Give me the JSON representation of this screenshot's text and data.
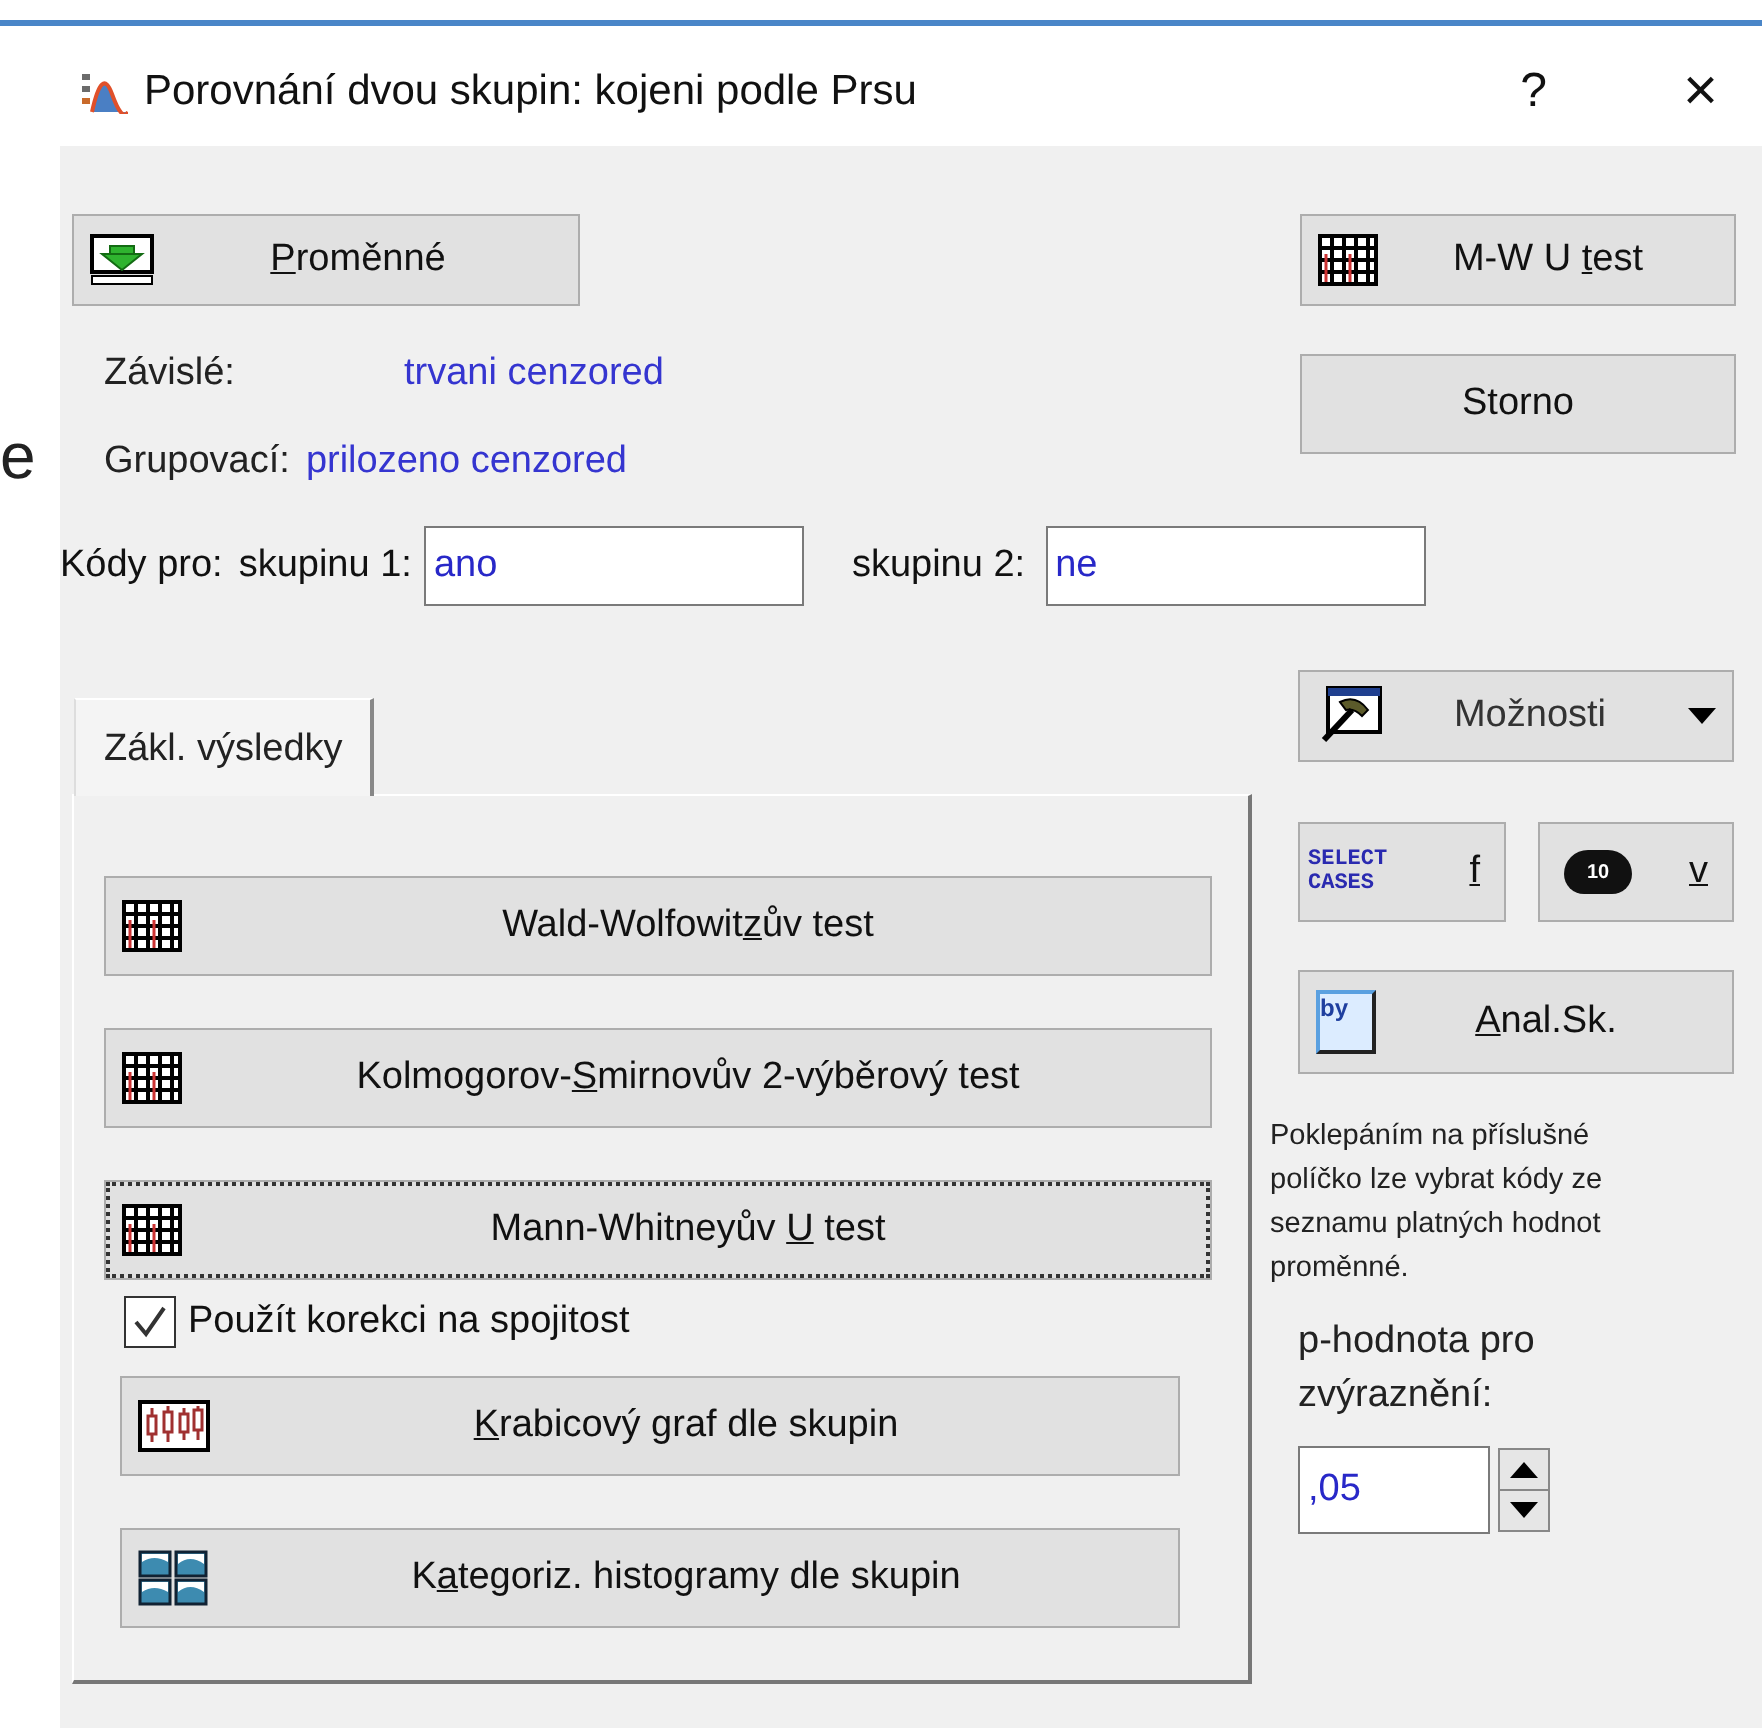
{
  "background_text": "e",
  "window": {
    "title": "Porovnání dvou skupin: kojeni podle Prsu",
    "help": "?",
    "close": "×"
  },
  "variables_button": {
    "key": "P",
    "post": "roměnné"
  },
  "mw_button": {
    "pre": "M-W U ",
    "key": "t",
    "post": "est"
  },
  "cancel_button": "Storno",
  "variables": [
    {
      "label": "Závislé:",
      "value": "trvani cenzored"
    },
    {
      "label": "Grupovací:",
      "value": "prilozeno cenzored"
    }
  ],
  "codes": {
    "label": "Kódy pro:",
    "group1_label": "skupinu 1:",
    "group1_value": "ano",
    "group2_label": "skupinu 2:",
    "group2_value": "ne"
  },
  "tabs": [
    {
      "label": "Zákl. výsledky",
      "selected": true
    }
  ],
  "tests": [
    {
      "kind": "table",
      "focused": false,
      "label": {
        "pre": "Wald-Wolfowit",
        "key": "z",
        "post": "ův test"
      }
    },
    {
      "kind": "table",
      "focused": false,
      "label": {
        "pre": "Kolmogorov-",
        "key": "S",
        "post": "mirnovův 2-výběrový test"
      }
    },
    {
      "kind": "table",
      "focused": true,
      "label": {
        "pre": "Mann-Whitneyův ",
        "key": "U",
        "post": " test"
      }
    },
    {
      "kind": "checkbox",
      "checked": true,
      "text": "Použít korekci na spojitost"
    },
    {
      "kind": "boxplot",
      "focused": false,
      "label": {
        "key": "K",
        "post": "rabicový graf dle skupin"
      }
    },
    {
      "kind": "histograms",
      "focused": false,
      "label": {
        "pre": "K",
        "key": "a",
        "post": "tegoriz. histogramy dle skupin"
      }
    }
  ],
  "options_button": "Možnosti",
  "select_cases_button": {
    "icon_text": "SELECT CASES",
    "key": "f"
  },
  "weight_button": {
    "icon_text": "10",
    "key": "v"
  },
  "by_group_button": {
    "icon_text": "by",
    "key": "A",
    "post": "nal.Sk."
  },
  "hint": "Poklepáním na příslušné políčko lze vybrat kódy ze seznamu platných hodnot proměnné.",
  "p_value": {
    "label": "p-hodnota pro zvýraznění:",
    "value": ",05"
  }
}
